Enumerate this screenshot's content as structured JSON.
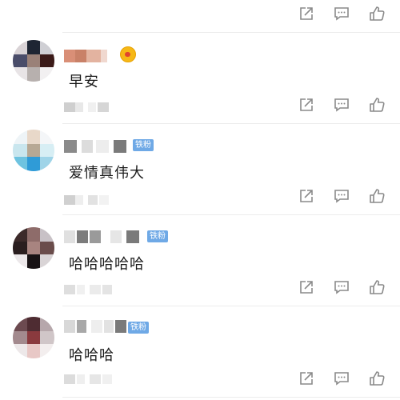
{
  "comments": [
    {
      "content": "早安",
      "badge": "",
      "has_emoji": true
    },
    {
      "content": "爱情真伟大",
      "badge": "铁粉",
      "has_emoji": false
    },
    {
      "content": "哈哈哈哈哈",
      "badge": "铁粉",
      "has_emoji": false
    },
    {
      "content": "哈哈哈",
      "badge": "铁粉",
      "has_emoji": false
    }
  ],
  "icons": {
    "share": "share-icon",
    "comment": "comment-icon",
    "like": "like-icon"
  },
  "colors": {
    "badge": "#6fa9e6",
    "icon": "#8a8a8a",
    "text": "#1a1a1a",
    "separator": "#ececec"
  }
}
